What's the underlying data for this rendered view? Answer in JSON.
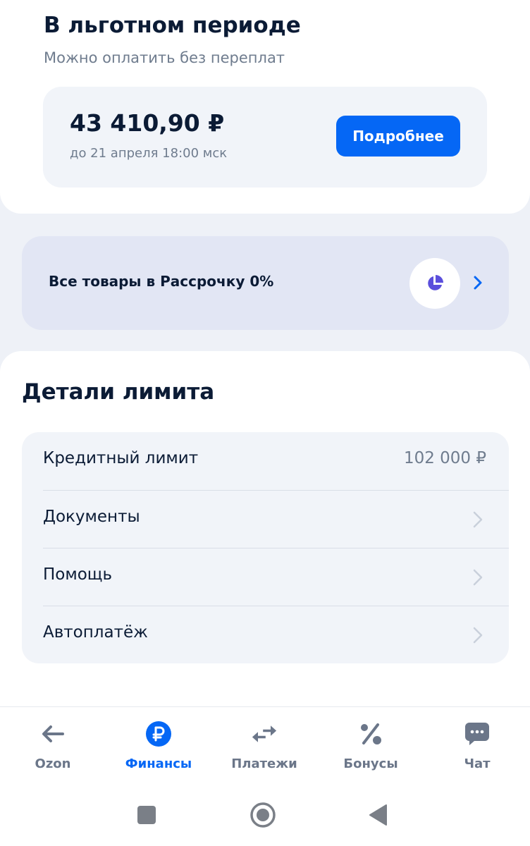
{
  "grace": {
    "title": "В льготном периоде",
    "subtitle": "Можно оплатить без переплат",
    "amount": "43 410,90 ₽",
    "due": "до 21 апреля 18:00 мск",
    "more_label": "Подробнее"
  },
  "banner": {
    "text": "Все товары в Рассрочку 0%",
    "icon": "pie-chart-icon"
  },
  "details": {
    "title": "Детали лимита",
    "rows": [
      {
        "label": "Кредитный лимит",
        "value": "102 000 ₽"
      },
      {
        "label": "Документы"
      },
      {
        "label": "Помощь"
      },
      {
        "label": "Автоплатёж"
      }
    ]
  },
  "tabbar": {
    "tabs": [
      {
        "label": "Ozon",
        "icon": "arrow-left-icon"
      },
      {
        "label": "Финансы",
        "icon": "ruble-icon",
        "active": true
      },
      {
        "label": "Платежи",
        "icon": "transfer-arrows-icon"
      },
      {
        "label": "Бонусы",
        "icon": "percent-icon"
      },
      {
        "label": "Чат",
        "icon": "chat-icon"
      }
    ]
  },
  "colors": {
    "accent": "#0567f5",
    "text_primary": "#0b1b35",
    "text_secondary": "#6f7c8e",
    "banner_bg": "#e2e6f4",
    "banner_icon": "#5b4fdc",
    "page_bg": "#eef1f7"
  }
}
